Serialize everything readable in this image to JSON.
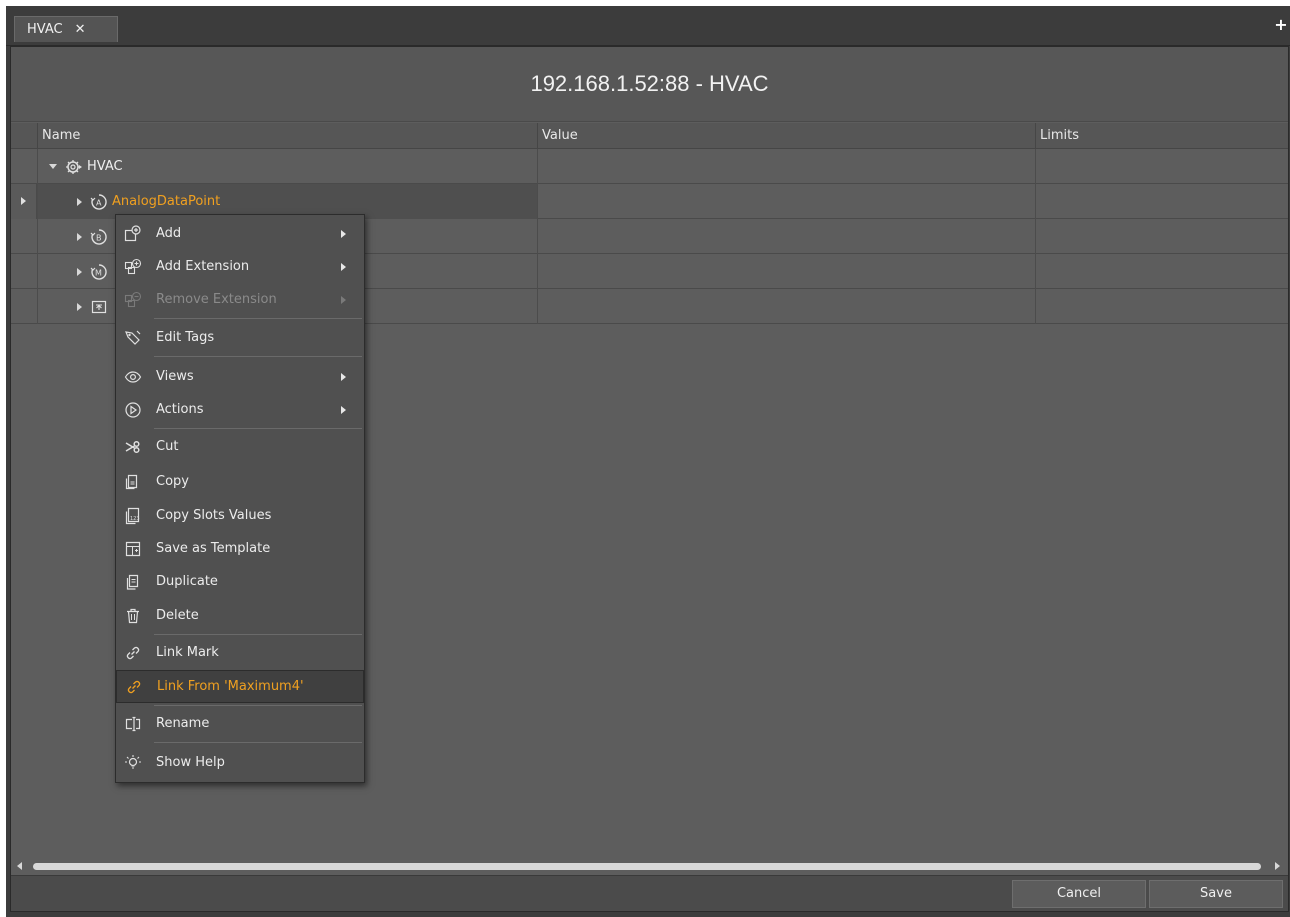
{
  "tab": {
    "label": "HVAC",
    "close": "✕",
    "add": "+"
  },
  "panel_title": "192.168.1.52:88 - HVAC",
  "columns": {
    "name": "Name",
    "value": "Value",
    "limits": "Limits"
  },
  "tree": {
    "root": "HVAC",
    "selected": "AnalogDataPoint"
  },
  "context_menu": {
    "add": "Add",
    "add_extension": "Add Extension",
    "remove_extension": "Remove Extension",
    "edit_tags": "Edit Tags",
    "views": "Views",
    "actions": "Actions",
    "cut": "Cut",
    "copy": "Copy",
    "copy_slots_values": "Copy Slots Values",
    "save_as_template": "Save as Template",
    "duplicate": "Duplicate",
    "delete": "Delete",
    "link_mark": "Link Mark",
    "link_from": "Link From 'Maximum4'",
    "rename": "Rename",
    "show_help": "Show Help"
  },
  "footer": {
    "cancel": "Cancel",
    "save": "Save"
  },
  "colors": {
    "accent": "#f0a020",
    "panel": "#5d5d5d",
    "menu": "#505050"
  }
}
